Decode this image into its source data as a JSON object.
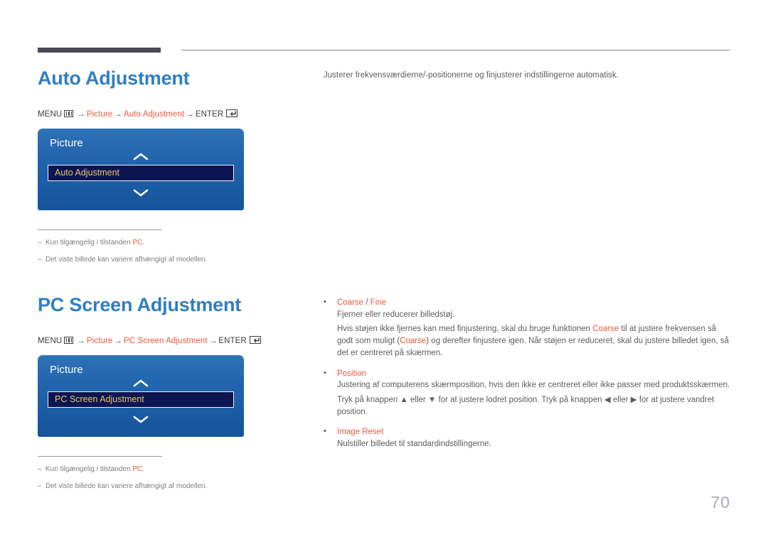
{
  "page": {
    "number": "70"
  },
  "sections": [
    {
      "title": "Auto Adjustment",
      "menu_path": {
        "menu_label": "MENU",
        "menu_icon": "menu-grid-icon",
        "arrow": "→",
        "items": [
          "Picture",
          "Auto Adjustment"
        ],
        "enter_label": "ENTER",
        "enter_icon": "enter-key-icon"
      },
      "osd": {
        "title": "Picture",
        "up_icon": "chevron-up-icon",
        "down_icon": "chevron-down-icon",
        "selected_item": "Auto Adjustment"
      },
      "notes": [
        {
          "dash": "–",
          "pre": "Kun tilgængelig i tilstanden ",
          "accent": "PC",
          "post": "."
        },
        {
          "dash": "–",
          "pre": "Det viste billede kan variere afhængigt af modellen.",
          "accent": "",
          "post": ""
        }
      ],
      "lede": "Justerer frekvensværdierne/-positionerne og finjusterer indstillingerne automatisk.",
      "bullets": []
    },
    {
      "title": "PC Screen Adjustment",
      "menu_path": {
        "menu_label": "MENU",
        "menu_icon": "menu-grid-icon",
        "arrow": "→",
        "items": [
          "Picture",
          "PC Screen Adjustment"
        ],
        "enter_label": "ENTER",
        "enter_icon": "enter-key-icon"
      },
      "osd": {
        "title": "Picture",
        "up_icon": "chevron-up-icon",
        "down_icon": "chevron-down-icon",
        "selected_item": "PC Screen Adjustment"
      },
      "notes": [
        {
          "dash": "–",
          "pre": "Kun tilgængelig i tilstanden ",
          "accent": "PC",
          "post": "."
        },
        {
          "dash": "–",
          "pre": "Det viste billede kan variere afhængigt af modellen.",
          "accent": "",
          "post": ""
        }
      ],
      "lede": "",
      "bullets": [
        {
          "dot": "•",
          "term_a": "Coarse",
          "sep": " / ",
          "term_b": "Fine",
          "lines": [
            "Fjerner eller reducerer billedstøj.",
            "Hvis støjen ikke fjernes kan med finjustering, skal du bruge funktionen @Coarse@ til at justere frekvensen så godt som muligt (@Coarse@) og derefter finjustere igen. Når støjen er reduceret, skal du justere billedet igen, så det er centreret på skærmen."
          ]
        },
        {
          "dot": "•",
          "term_a": "Position",
          "sep": "",
          "term_b": "",
          "lines": [
            "Justering af computerens skærmposition, hvis den ikke er centreret eller ikke passer med produktsskærmen.",
            "Tryk på knappen ▲ eller ▼ for at justere lodret position. Tryk på knappen ◀ eller ▶ for at justere vandret position."
          ]
        },
        {
          "dot": "•",
          "term_a": "Image Reset",
          "sep": "",
          "term_b": "",
          "lines": [
            "Nulstiller billedet til standardindstillingerne."
          ]
        }
      ]
    }
  ],
  "colors": {
    "heading": "#2f7fc1",
    "accent": "#e8593a",
    "osd_blue": "#1f63ad",
    "osd_item_bg": "#0c1452",
    "osd_item_text": "#e7c96a",
    "rule_dark": "#4a4a55"
  }
}
